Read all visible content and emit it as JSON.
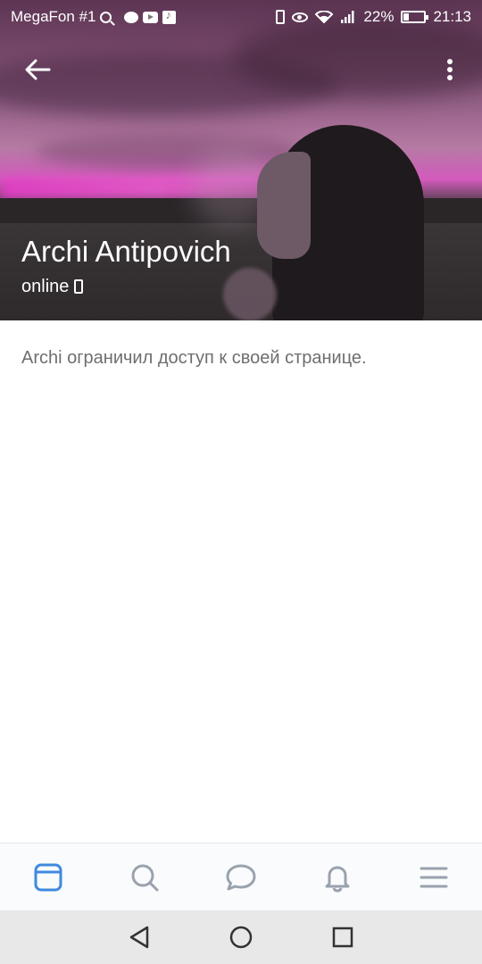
{
  "statusbar": {
    "carrier": "MegaFon #1",
    "battery": "22%",
    "time": "21:13"
  },
  "profile": {
    "name": "Archi Antipovich",
    "status": "online",
    "restricted_message": "Archi ограничил доступ к своей странице."
  },
  "colors": {
    "accent": "#3f8ae0",
    "nav_icon": "#99a2ad",
    "body_text": "#6e6e6e"
  },
  "bottom_nav": [
    {
      "icon": "newsfeed-icon",
      "active": true
    },
    {
      "icon": "search-icon",
      "active": false
    },
    {
      "icon": "messages-icon",
      "active": false
    },
    {
      "icon": "notifications-icon",
      "active": false
    },
    {
      "icon": "menu-icon",
      "active": false
    }
  ],
  "system_nav": [
    "back-triangle-icon",
    "home-circle-icon",
    "recents-square-icon"
  ]
}
